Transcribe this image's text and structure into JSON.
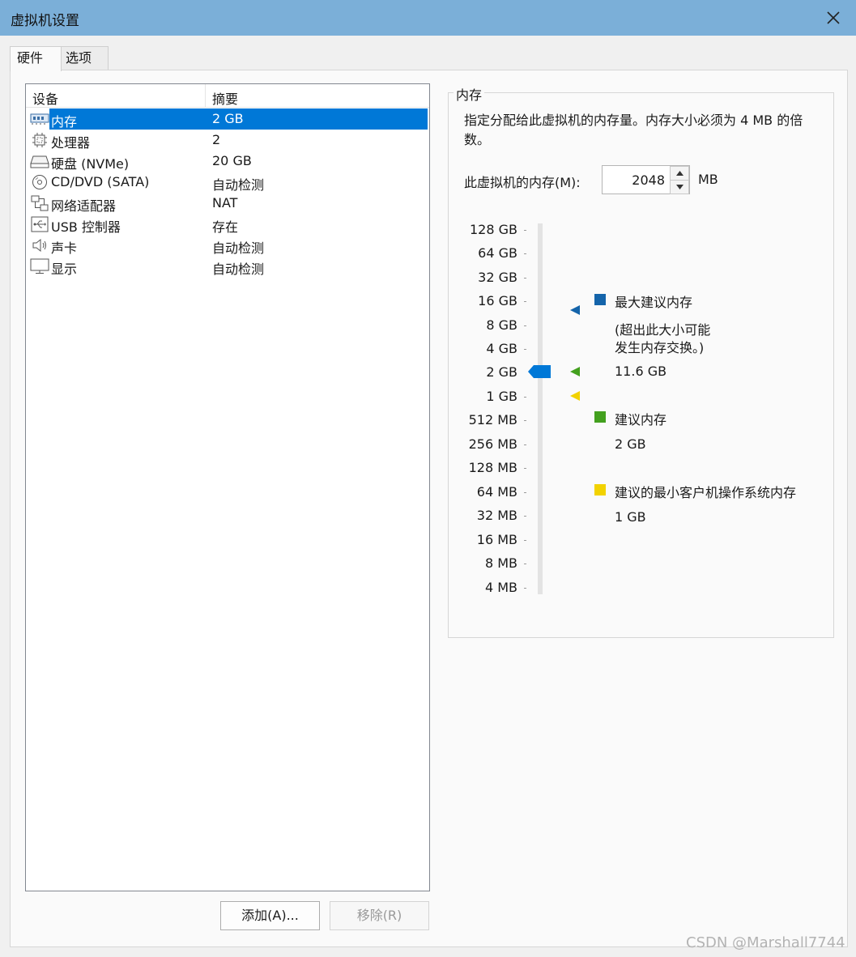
{
  "window": {
    "title": "虚拟机设置"
  },
  "tabs": [
    {
      "label": "硬件"
    },
    {
      "label": "选项"
    }
  ],
  "device_list": {
    "columns": {
      "device": "设备",
      "summary": "摘要"
    },
    "rows": [
      {
        "name": "内存",
        "summary": "2 GB",
        "icon": "memory-icon",
        "selected": true
      },
      {
        "name": "处理器",
        "summary": "2",
        "icon": "processor-icon"
      },
      {
        "name": "硬盘 (NVMe)",
        "summary": "20 GB",
        "icon": "hard-disk-icon"
      },
      {
        "name": "CD/DVD (SATA)",
        "summary": "自动检测",
        "icon": "cd-dvd-icon"
      },
      {
        "name": "网络适配器",
        "summary": "NAT",
        "icon": "network-adapter-icon"
      },
      {
        "name": "USB 控制器",
        "summary": "存在",
        "icon": "usb-icon"
      },
      {
        "name": "声卡",
        "summary": "自动检测",
        "icon": "speaker-icon"
      },
      {
        "name": "显示",
        "summary": "自动检测",
        "icon": "display-icon"
      }
    ]
  },
  "buttons": {
    "add": "添加(A)...",
    "remove": "移除(R)"
  },
  "memory_panel": {
    "group_title": "内存",
    "description": "指定分配给此虚拟机的内存量。内存大小必须为 4 MB 的倍数。",
    "label": "此虚拟机的内存(M):",
    "value": "2048",
    "unit": "MB",
    "scale_labels": [
      "128 GB",
      "64 GB",
      "32 GB",
      "16 GB",
      "8 GB",
      "4 GB",
      "2 GB",
      "1 GB",
      "512 MB",
      "256 MB",
      "128 MB",
      "64 MB",
      "32 MB",
      "16 MB",
      "8 MB",
      "4 MB"
    ],
    "current": "2 GB",
    "legend": {
      "max_title": "最大建议内存",
      "max_note_line1": "(超出此大小可能",
      "max_note_line2": "发生内存交换。)",
      "max_value": "11.6 GB",
      "recommended_title": "建议内存",
      "recommended_value": "2 GB",
      "min_title": "建议的最小客户机操作系统内存",
      "min_value": "1 GB"
    }
  },
  "colors": {
    "max_marker": "#1464aa",
    "recommended_marker": "#43a01e",
    "min_marker": "#f2d200",
    "slider_thumb": "#0078d7",
    "selection": "#0078d7"
  },
  "watermark": "CSDN @Marshall7744"
}
